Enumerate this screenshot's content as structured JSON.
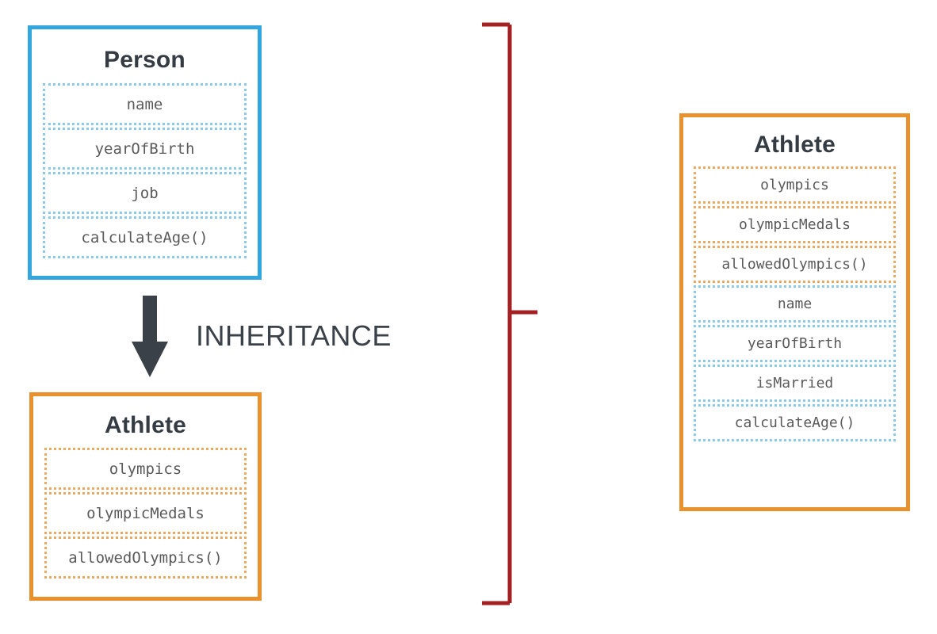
{
  "diagram": {
    "title": "JavaScript class inheritance diagram",
    "colors": {
      "blue_border": "#33a6df",
      "blue_dotted": "#8cc9e8",
      "orange_border": "#e8912d",
      "orange_dotted": "#e9a961",
      "bracket_red": "#a52022",
      "arrow_gray": "#3a4149",
      "title_text": "#343b43",
      "row_text": "#5a5a5a",
      "background": "#ffffff"
    },
    "parent_class": {
      "name": "Person",
      "border_color": "#33a6df",
      "members": [
        {
          "label": "name",
          "kind": "property",
          "origin": "own",
          "style": "blue"
        },
        {
          "label": "yearOfBirth",
          "kind": "property",
          "origin": "own",
          "style": "blue"
        },
        {
          "label": "job",
          "kind": "property",
          "origin": "own",
          "style": "blue"
        },
        {
          "label": "calculateAge()",
          "kind": "method",
          "origin": "own",
          "style": "blue"
        }
      ]
    },
    "child_class": {
      "name": "Athlete",
      "border_color": "#e8912d",
      "members": [
        {
          "label": "olympics",
          "kind": "property",
          "origin": "own",
          "style": "orange"
        },
        {
          "label": "olympicMedals",
          "kind": "property",
          "origin": "own",
          "style": "orange"
        },
        {
          "label": "allowedOlympics()",
          "kind": "method",
          "origin": "own",
          "style": "orange"
        }
      ]
    },
    "merged_class": {
      "name": "Athlete",
      "border_color": "#e8912d",
      "members": [
        {
          "label": "olympics",
          "kind": "property",
          "origin": "own",
          "style": "orange"
        },
        {
          "label": "olympicMedals",
          "kind": "property",
          "origin": "own",
          "style": "orange"
        },
        {
          "label": "allowedOlympics()",
          "kind": "method",
          "origin": "own",
          "style": "orange"
        },
        {
          "label": "name",
          "kind": "property",
          "origin": "inherited",
          "style": "blue"
        },
        {
          "label": "yearOfBirth",
          "kind": "property",
          "origin": "inherited",
          "style": "blue"
        },
        {
          "label": "isMarried",
          "kind": "property",
          "origin": "inherited",
          "style": "blue"
        },
        {
          "label": "calculateAge()",
          "kind": "method",
          "origin": "inherited",
          "style": "blue"
        }
      ]
    },
    "relationship": {
      "label": "INHERITANCE",
      "arrow_direction": "down",
      "arrow_color": "#3a4149"
    },
    "bracket": {
      "color": "#a52022",
      "orientation": "right-facing",
      "meaning": "result of combining"
    }
  }
}
